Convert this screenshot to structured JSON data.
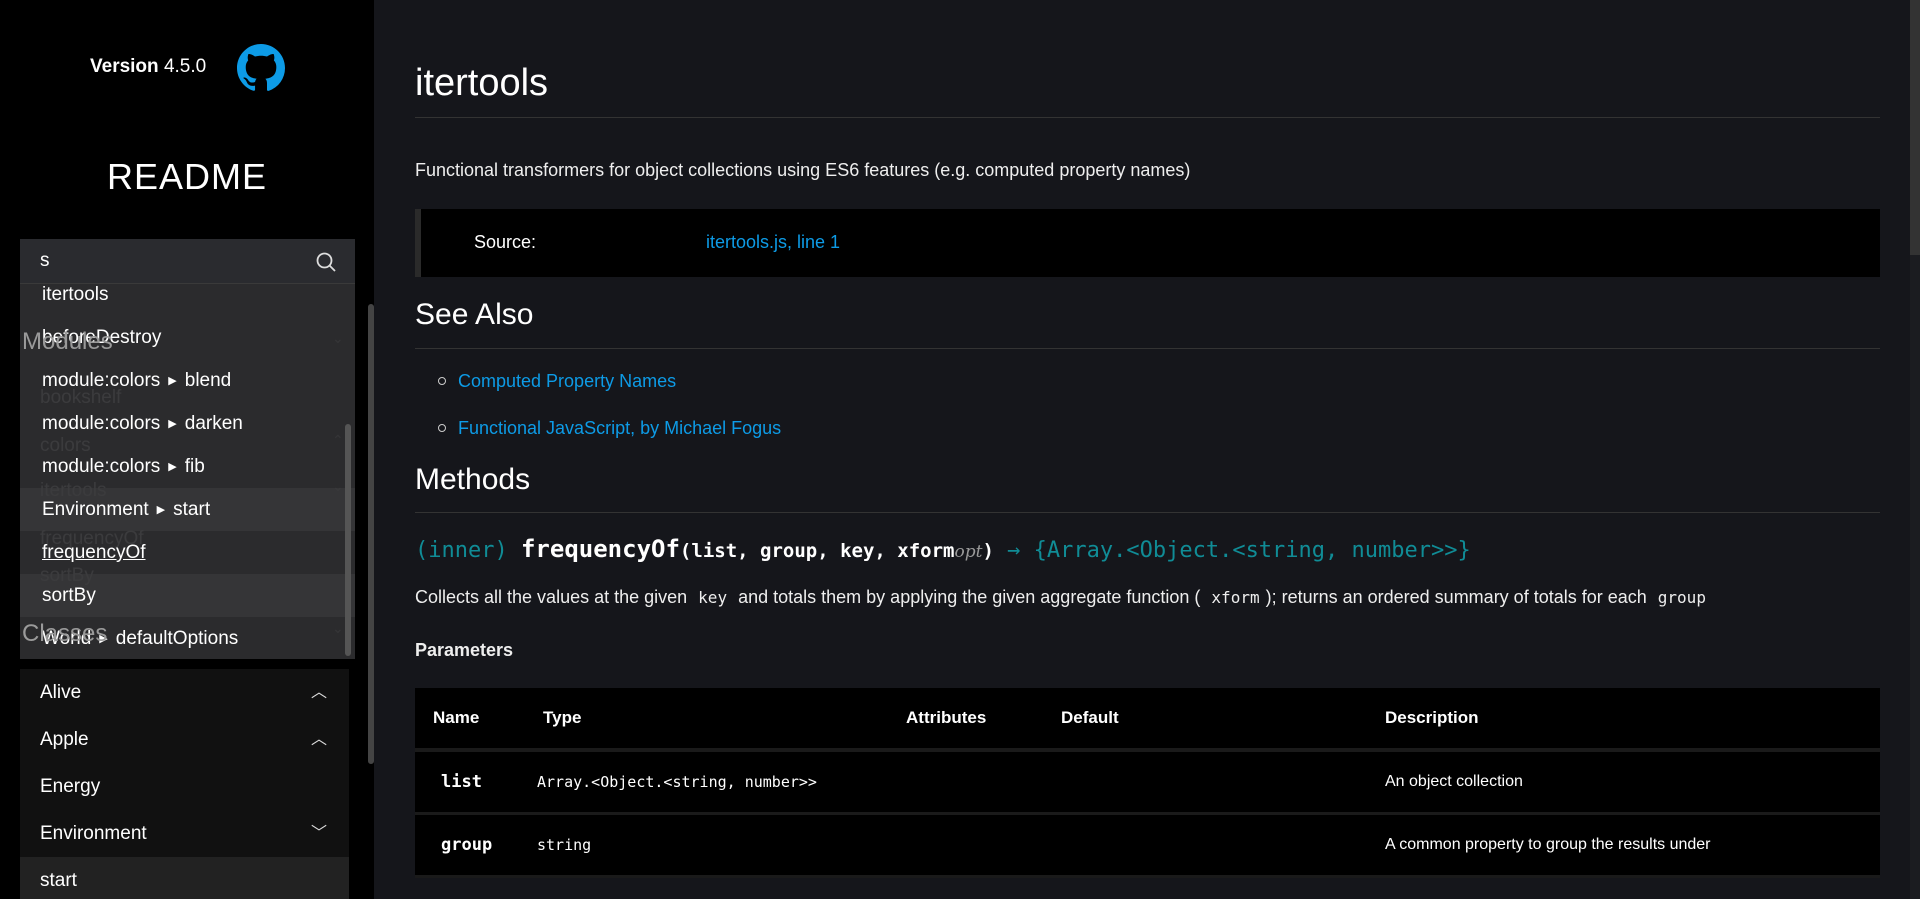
{
  "sidebar": {
    "version_label": "Version",
    "version": "4.5.0",
    "github_icon": "github-icon",
    "readme": "README",
    "search": {
      "value": "s",
      "icon": "search-icon"
    },
    "background_nav": {
      "modules": "Modules",
      "items": [
        "bookshelf",
        "colors",
        "itertools",
        "frequencyOf",
        "sortBy"
      ],
      "classes": "Classes"
    },
    "dropdown": [
      {
        "text": "itertools"
      },
      {
        "text": "beforeDestroy"
      },
      {
        "parent": "module:colors",
        "text": "blend"
      },
      {
        "parent": "module:colors",
        "text": "darken"
      },
      {
        "parent": "module:colors",
        "text": "fib"
      },
      {
        "parent": "Environment",
        "text": "start"
      },
      {
        "text": "frequencyOf"
      },
      {
        "text": "sortBy"
      },
      {
        "parent": "World",
        "text": "defaultOptions"
      }
    ],
    "nav": [
      {
        "label": "Alive",
        "chevron": "up"
      },
      {
        "label": "Apple",
        "chevron": "up"
      },
      {
        "label": "Energy"
      },
      {
        "label": "Environment",
        "chevron": "down"
      },
      {
        "label": "start"
      }
    ]
  },
  "main": {
    "title": "itertools",
    "description": "Functional transformers for object collections using ES6 features (e.g. computed property names)",
    "source_label": "Source:",
    "source_link": "itertools.js, line 1",
    "see_also_title": "See Also",
    "see_also": [
      "Computed Property Names",
      "Functional JavaScript, by Michael Fogus"
    ],
    "methods_title": "Methods",
    "method": {
      "scope": "(inner)",
      "name": "frequencyOf",
      "params_open": "(",
      "params": "list, group, key, xform",
      "opt": "opt",
      "params_close": ")",
      "arrow": "→",
      "returns": "{Array.<Object.<string, number>>}",
      "desc_1": "Collects all the values at the given",
      "desc_key": "key",
      "desc_2": "and totals them by applying the given aggregate function (",
      "desc_xform": "xform",
      "desc_3": "); returns an ordered summary of totals for each",
      "desc_group": "group"
    },
    "parameters_title": "Parameters",
    "table": {
      "headers": [
        "Name",
        "Type",
        "Attributes",
        "Default",
        "Description"
      ],
      "rows": [
        [
          "list",
          "Array.<Object.<string, number>>",
          "",
          "",
          "An object collection"
        ],
        [
          "group",
          "string",
          "",
          "",
          "A common property to group the results under"
        ]
      ]
    }
  },
  "colors": {
    "link": "#0d9be6",
    "signature_teal": "#108c96",
    "sidebar_bg": "#000000",
    "main_bg": "#15161b"
  }
}
